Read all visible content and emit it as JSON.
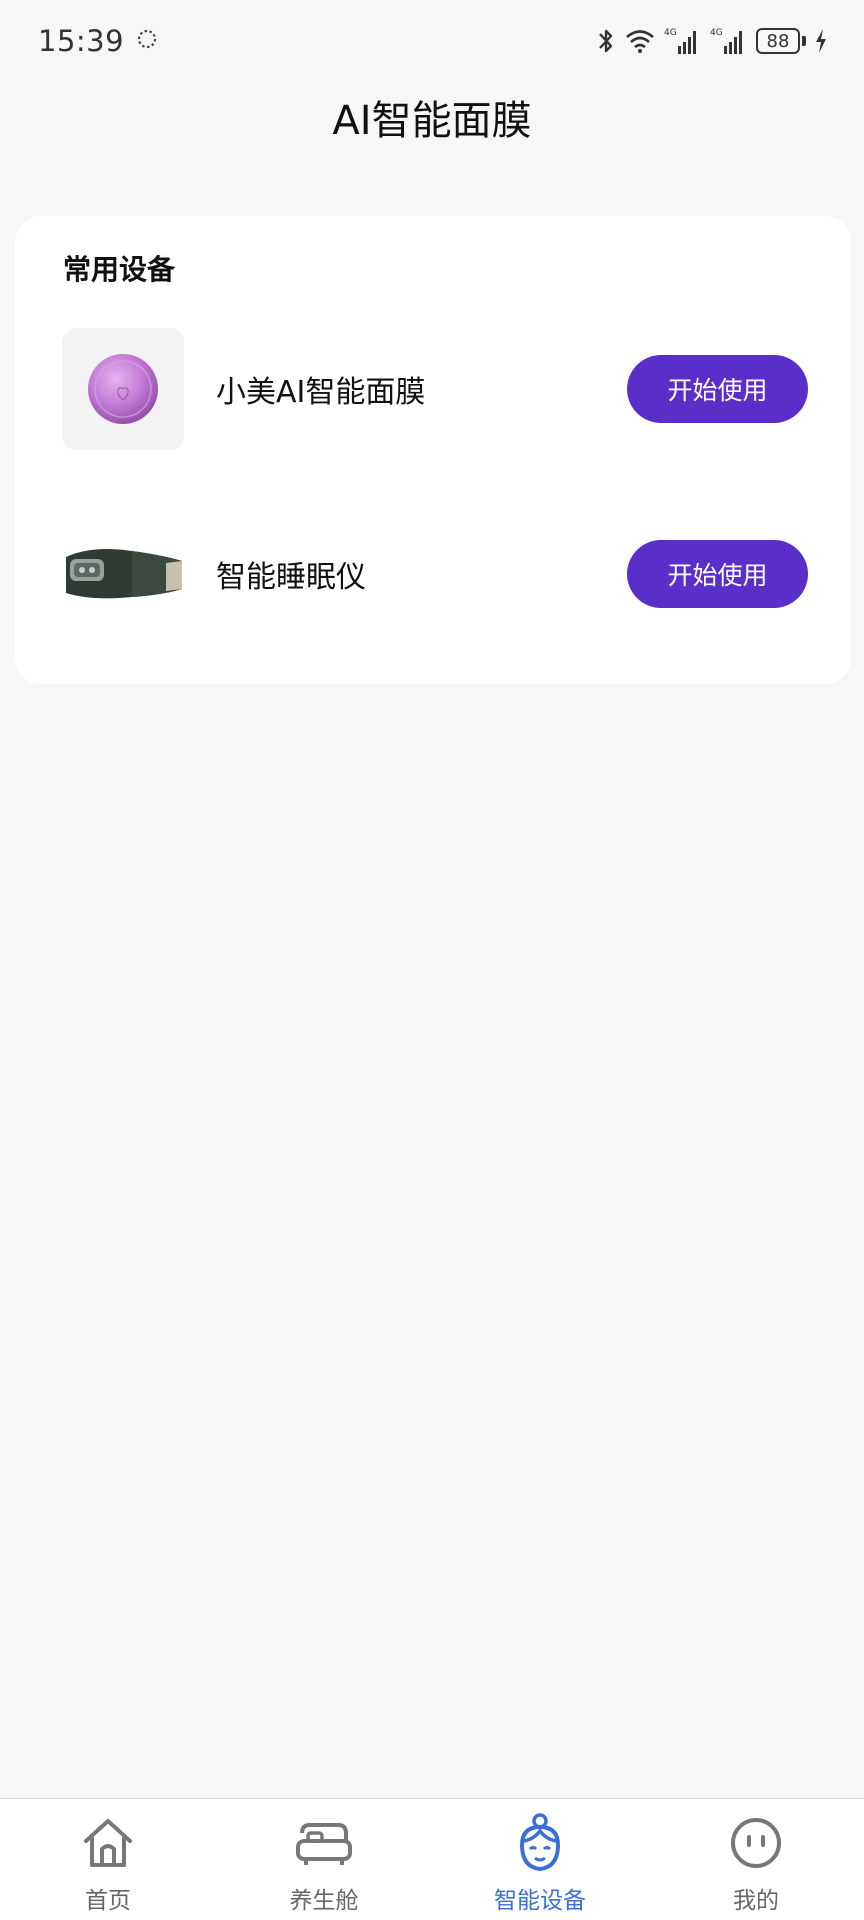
{
  "status_bar": {
    "time": "15:39",
    "battery": "88",
    "network_1": "4G",
    "network_2": "4G",
    "icons": [
      "loading-icon",
      "bluetooth-icon",
      "wifi-icon",
      "signal-icon",
      "battery-icon",
      "charging-icon"
    ]
  },
  "page": {
    "title": "AI智能面膜"
  },
  "devices_card": {
    "title": "常用设备",
    "items": [
      {
        "name": "小美AI智能面膜",
        "button": "开始使用",
        "image": "face-mask-device"
      },
      {
        "name": "智能睡眠仪",
        "button": "开始使用",
        "image": "sleep-eye-mask"
      }
    ]
  },
  "bottom_nav": {
    "items": [
      {
        "label": "首页",
        "icon": "home-icon",
        "active": false
      },
      {
        "label": "养生舱",
        "icon": "capsule-icon",
        "active": false
      },
      {
        "label": "智能设备",
        "icon": "lady-face-icon",
        "active": true
      },
      {
        "label": "我的",
        "icon": "smile-face-icon",
        "active": false
      }
    ]
  },
  "colors": {
    "accent_button": "#5a2fc9",
    "nav_active": "#3a6fd8",
    "background": "#f7f7f7"
  }
}
